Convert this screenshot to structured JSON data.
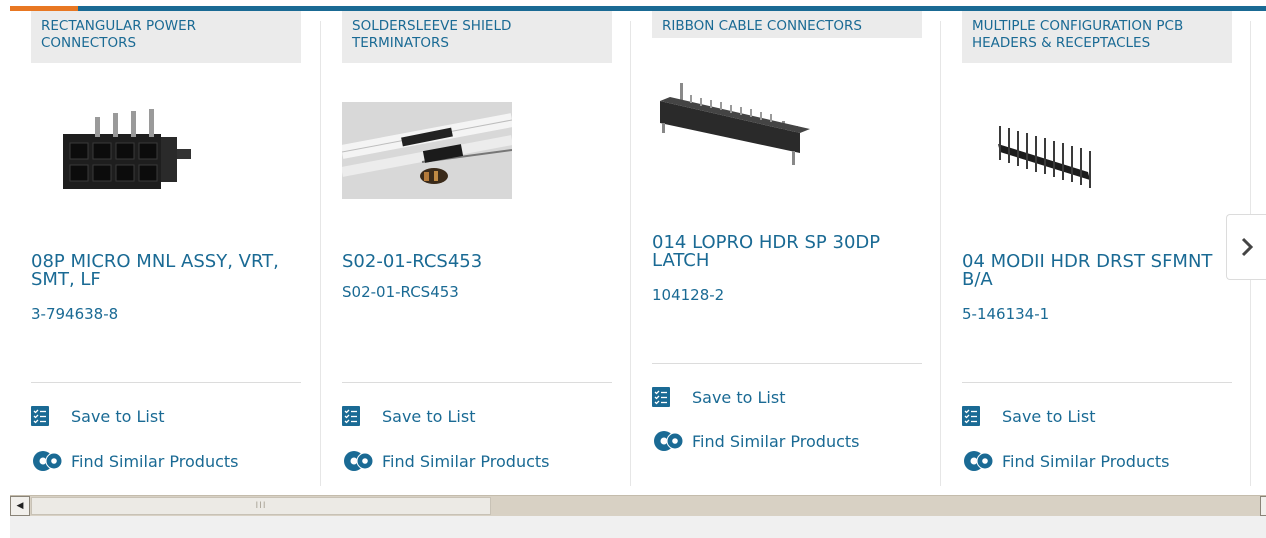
{
  "cards": [
    {
      "category": "RECTANGULAR POWER CONNECTORS",
      "title": "08P MICRO MNL ASSY, VRT, SMT, LF",
      "part_number": "3-794638-8",
      "save_label": "Save to List",
      "similar_label": "Find Similar Products"
    },
    {
      "category": "SOLDERSLEEVE SHIELD TERMINATORS",
      "title": "S02-01-RCS453",
      "part_number": "S02-01-RCS453",
      "save_label": "Save to List",
      "similar_label": "Find Similar Products"
    },
    {
      "category": "RIBBON CABLE CONNECTORS",
      "title": "014 LOPRO HDR SP 30DP LATCH",
      "part_number": "104128-2",
      "save_label": "Save to List",
      "similar_label": "Find Similar Products"
    },
    {
      "category": "MULTIPLE CONFIGURATION PCB HEADERS & RECEPTACLES",
      "title": "04 MODII HDR DRST SFMNT B/A",
      "part_number": "5-146134-1",
      "save_label": "Save to List",
      "similar_label": "Find Similar Products"
    }
  ],
  "next_icon": "chevron-right-icon",
  "scrollbar": {
    "left_arrow": "◀",
    "thumb_grip": "III"
  },
  "colors": {
    "accent_blue": "#1a6a94",
    "accent_orange": "#e87722"
  }
}
